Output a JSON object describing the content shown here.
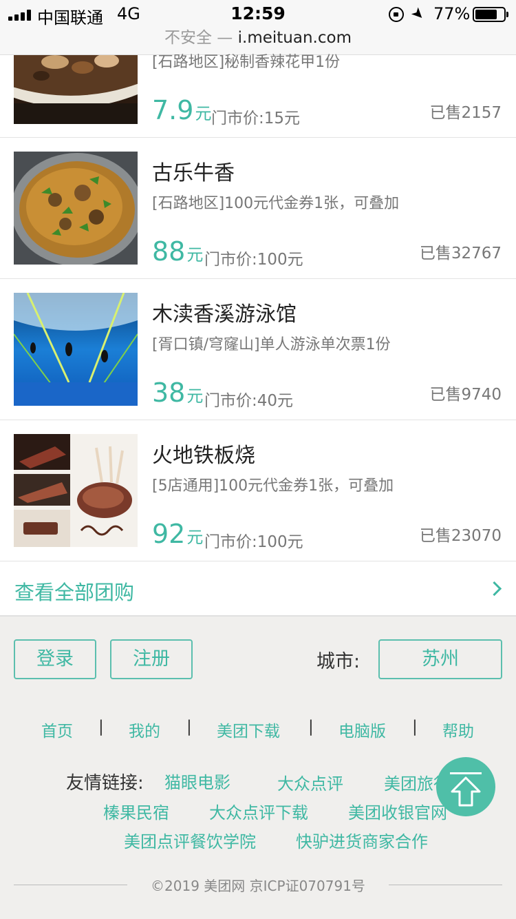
{
  "status_bar": {
    "carrier": "中国联通",
    "network": "4G",
    "time": "12:59",
    "battery_percent": "77%",
    "battery_level": 0.77
  },
  "browser": {
    "security_label": "不安全",
    "separator": " — ",
    "host": "i.meituan.com"
  },
  "deals": [
    {
      "title": "",
      "desc": "[石路地区]秘制香辣花甲1份",
      "price": "7.9",
      "unit": "元",
      "original": "门市价:15元",
      "sold": "已售2157"
    },
    {
      "title": "古乐牛香",
      "desc": "[石路地区]100元代金券1张，可叠加",
      "price": "88",
      "unit": "元",
      "original": "门市价:100元",
      "sold": "已售32767"
    },
    {
      "title": "木渎香溪游泳馆",
      "desc": "[胥口镇/穹窿山]单人游泳单次票1份",
      "price": "38",
      "unit": "元",
      "original": "门市价:40元",
      "sold": "已售9740"
    },
    {
      "title": "火地铁板烧",
      "desc": "[5店通用]100元代金券1张，可叠加",
      "price": "92",
      "unit": "元",
      "original": "门市价:100元",
      "sold": "已售23070"
    }
  ],
  "view_all": "查看全部团购",
  "footer": {
    "login": "登录",
    "register": "注册",
    "city_label": "城市:",
    "city": "苏州",
    "nav": [
      "首页",
      "我的",
      "美团下载",
      "电脑版",
      "帮助"
    ],
    "nav_separator": "|",
    "friends_label": "友情链接:",
    "friend_links": [
      "猫眼电影",
      "大众点评",
      "美团旅行",
      "榛果民宿",
      "大众点评下载",
      "美团收银官网",
      "美团点评餐饮学院",
      "快驴进货商家合作"
    ],
    "copyright": "©2019 美团网 京ICP证070791号"
  },
  "colors": {
    "accent": "#3fb8a3",
    "scroll_button": "#4fbfa8"
  }
}
